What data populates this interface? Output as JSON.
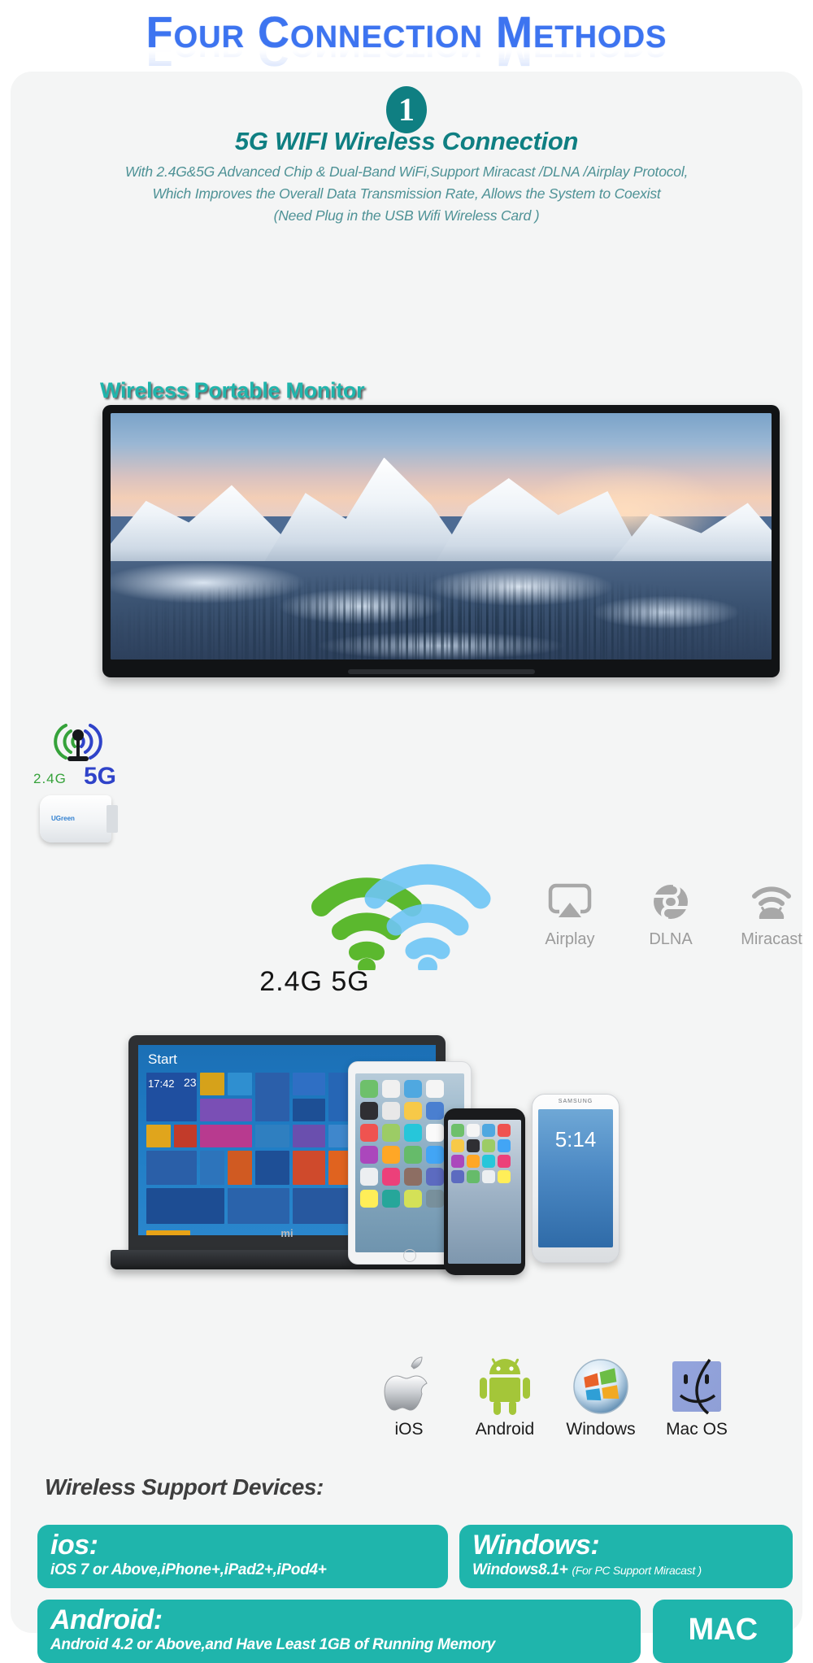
{
  "page_title": "Four Connection Methods",
  "section": {
    "number": "1",
    "heading": "5G WIFI Wireless Connection",
    "description_lines": [
      "With 2.4G&5G Advanced Chip & Dual-Band WiFi,Support Miracast /DLNA /Airplay Protocol,",
      "Which Improves the Overall Data Transmission Rate, Allows the System to Coexist",
      "(Need Plug in the USB Wifi Wireless Card )"
    ]
  },
  "monitor": {
    "label": "Wireless Portable Monitor"
  },
  "dongle": {
    "band_24": "2.4G",
    "band_5": "5G",
    "brand": "UGreen"
  },
  "wifi": {
    "bands_label": "2.4G 5G"
  },
  "protocols": [
    {
      "name": "Airplay",
      "icon": "airplay-icon"
    },
    {
      "name": "DLNA",
      "icon": "dlna-icon"
    },
    {
      "name": "Miracast",
      "icon": "miracast-icon"
    }
  ],
  "laptop": {
    "start_label": "Start",
    "clock": "17:42",
    "date": "23",
    "brand": "mi"
  },
  "samsung": {
    "brand": "SAMSUNG",
    "time": "5:14"
  },
  "os_support": [
    {
      "name": "iOS",
      "icon": "apple-icon"
    },
    {
      "name": "Android",
      "icon": "android-icon"
    },
    {
      "name": "Windows",
      "icon": "windows-icon"
    },
    {
      "name": "Mac OS",
      "icon": "finder-icon"
    }
  ],
  "support": {
    "title": "Wireless Support Devices:",
    "boxes": [
      {
        "id": "ios",
        "heading": "ios:",
        "detail": "iOS 7 or Above,iPhone+,iPad2+,iPod4+",
        "note": ""
      },
      {
        "id": "windows",
        "heading": "Windows:",
        "detail": "Windows8.1+",
        "note": "(For PC Support Miracast )"
      },
      {
        "id": "android",
        "heading": "Android:",
        "detail": "Android 4.2 or Above,and Have Least 1GB of Running Memory",
        "note": ""
      },
      {
        "id": "mac",
        "heading": "MAC",
        "detail": "",
        "note": ""
      }
    ]
  },
  "colors": {
    "title_blue": "#3d74f0",
    "teal_dark": "#0f7f82",
    "teal_desc": "#4e9296",
    "teal_bright": "#1fb5ac",
    "card_bg": "#f4f5f5",
    "green_24g": "#35a23a",
    "blue_5g": "#2f43c9",
    "gray_icon": "#9b9b9b"
  }
}
